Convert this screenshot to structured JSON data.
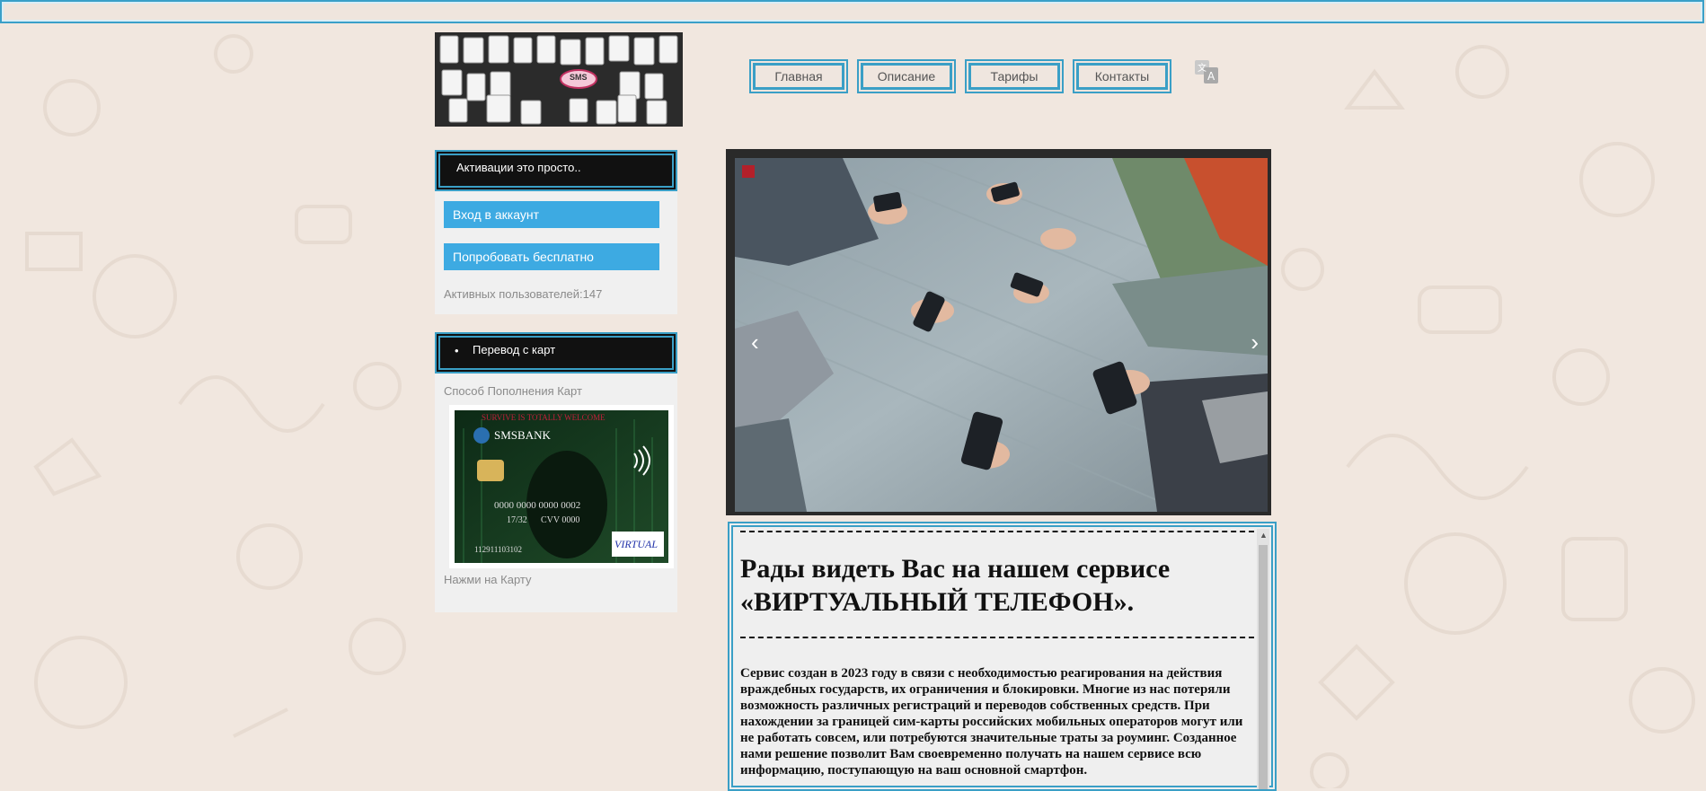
{
  "nav": {
    "items": [
      "Главная",
      "Описание",
      "Тарифы",
      "Контакты"
    ]
  },
  "logo": {
    "badge": "SMS"
  },
  "sidebar": {
    "panel1": {
      "header": "Активации это просто..",
      "login_button": "Вход в аккаунт",
      "trial_button": "Попробовать бесплатно",
      "active_users": "Активных пользователей:147"
    },
    "panel2": {
      "header": "Перевод с карт",
      "caption": "Способ Пополнения Карт",
      "card": {
        "top_text": "SURVIVE IS TOTALLY WELCOME",
        "bank": "SMSBANK",
        "number": "0000 0000 0000 0002",
        "expiry": "17/32",
        "cvv": "CVV 0000",
        "id": "112911103102",
        "brand": "VIRTUAL"
      },
      "footer": "Нажми на Карту"
    }
  },
  "slider": {
    "prev_icon": "chevron-left-icon",
    "next_icon": "chevron-right-icon"
  },
  "content": {
    "title": "Рады видеть Вас на нашем сервисе «ВИРТУАЛЬНЫЙ ТЕЛЕФОН».",
    "paragraph": "Сервис создан в 2023 году в связи с необходимостью реагирования на действия враждебных государств, их ограничения и блокировки. Многие из нас потеряли возможность различных регистраций и переводов собственных средств. При нахождении за границей сим-карты российских мобильных операторов могут или не работать совсем, или потребуются значительные траты за роуминг. Созданное нами решение позволит Вам своевременно получать на нашем сервисе всю информацию, поступающую на ваш основной смартфон."
  },
  "colors": {
    "accent": "#3a9fc6",
    "button_blue": "#3daae2",
    "background": "#f1e7df",
    "panel_header": "#111111"
  }
}
